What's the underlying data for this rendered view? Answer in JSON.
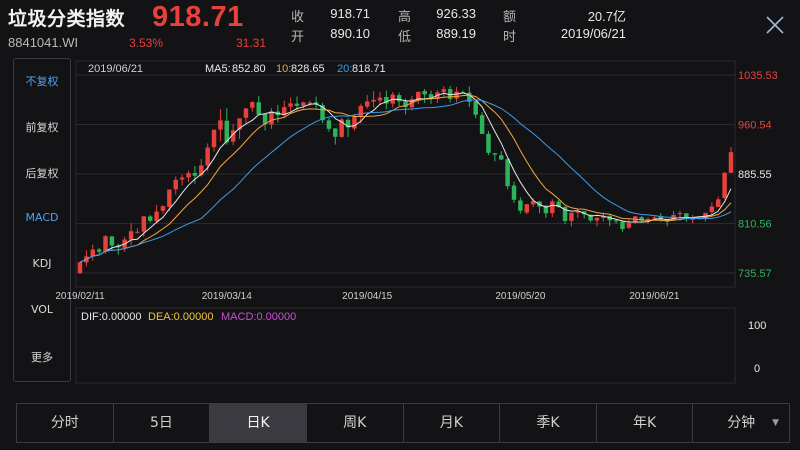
{
  "header": {
    "title": "垃圾分类指数",
    "code": "8841041.WI",
    "price": "918.71",
    "change_pct": "3.53%",
    "change": "31.31",
    "quote": [
      {
        "label": "收",
        "value": "918.71"
      },
      {
        "label": "开",
        "value": "890.10"
      },
      {
        "label": "高",
        "value": "926.33"
      },
      {
        "label": "低",
        "value": "889.19"
      },
      {
        "label": "额",
        "value": "20.7亿"
      },
      {
        "label": "时",
        "value": "2019/06/21"
      }
    ],
    "close_icon": "close-icon"
  },
  "sidebar": {
    "items": [
      {
        "label": "不复权",
        "active": true
      },
      {
        "label": "前复权",
        "active": false
      },
      {
        "label": "后复权",
        "active": false
      },
      {
        "label": "MACD",
        "active": true
      },
      {
        "label": "KDJ",
        "active": false
      },
      {
        "label": "VOL",
        "active": false
      },
      {
        "label": "更多",
        "active": false
      }
    ]
  },
  "legend": {
    "date": "2019/06/21",
    "ma5_label": "MA5:",
    "ma5_value": "852.80",
    "ma10_label": "10:",
    "ma10_value": "828.65",
    "ma20_label": "20:",
    "ma20_value": "818.71"
  },
  "macd_legend": {
    "dif": "DIF:0.00000",
    "dea": "DEA:0.00000",
    "macd": "MACD:0.00000",
    "axis_top": "100",
    "axis_bottom": "0"
  },
  "colors": {
    "up": "#e8403a",
    "down": "#2fb35a",
    "ma5": "#e8e8e8",
    "ma10": "#f2a83a",
    "ma20": "#3d9be9",
    "dea": "#f2c53d",
    "macd": "#c94fd6",
    "grid": "#2a2a30"
  },
  "chart_data": {
    "type": "candlestick",
    "y_ticks": [
      {
        "value": 1035.53,
        "label": "1035.53",
        "color": "#e8403a"
      },
      {
        "value": 960.54,
        "label": "960.54",
        "color": "#e8403a"
      },
      {
        "value": 885.55,
        "label": "885.55",
        "color": "#e8e8e8"
      },
      {
        "value": 810.56,
        "label": "810.56",
        "color": "#2fb35a"
      },
      {
        "value": 735.57,
        "label": "735.57",
        "color": "#2fb35a"
      }
    ],
    "ylim": [
      735.57,
      1035.53
    ],
    "x_ticks": [
      {
        "index": 0,
        "label": "2019/02/11"
      },
      {
        "index": 23,
        "label": "2019/03/14"
      },
      {
        "index": 45,
        "label": "2019/04/15"
      },
      {
        "index": 69,
        "label": "2019/05/20"
      },
      {
        "index": 90,
        "label": "2019/06/21"
      }
    ],
    "candles": [
      [
        735.3,
        751.9,
        734.2,
        752.3
      ],
      [
        751.6,
        760.7,
        745.7,
        770.0
      ],
      [
        761.2,
        771.2,
        754.2,
        778.5
      ],
      [
        771.2,
        767.8,
        764.1,
        773.6
      ],
      [
        768.1,
        791.2,
        764.6,
        793.2
      ],
      [
        791.0,
        777.2,
        770.0,
        791.9
      ],
      [
        777.1,
        774.4,
        763.3,
        780.0
      ],
      [
        773.2,
        786.3,
        767.8,
        790.1
      ],
      [
        786.2,
        798.9,
        778.1,
        811.0
      ],
      [
        797.8,
        798.0,
        795.5,
        803.2
      ],
      [
        798.3,
        821.5,
        790.4,
        822.0
      ],
      [
        821.3,
        814.6,
        812.0,
        823.3
      ],
      [
        814.1,
        828.6,
        810.5,
        838.7
      ],
      [
        829.7,
        836.9,
        825.4,
        837.9
      ],
      [
        835.7,
        862.1,
        829.4,
        862.1
      ],
      [
        862.3,
        876.8,
        854.6,
        882.0
      ],
      [
        877.2,
        880.1,
        868.2,
        884.5
      ],
      [
        880.4,
        886.9,
        873.6,
        890.6
      ],
      [
        887.1,
        883.0,
        870.8,
        897.7
      ],
      [
        883.8,
        898.6,
        881.4,
        908.5
      ],
      [
        898.5,
        925.6,
        889.8,
        931.9
      ],
      [
        926.3,
        952.6,
        919.7,
        952.6
      ],
      [
        953.0,
        966.8,
        935.1,
        983.8
      ],
      [
        966.2,
        933.6,
        929.9,
        985.1
      ],
      [
        934.6,
        951.7,
        929.3,
        961.2
      ],
      [
        952.7,
        969.9,
        938.6,
        969.9
      ],
      [
        970.7,
        984.8,
        962.2,
        985.7
      ],
      [
        986.1,
        994.5,
        980.0,
        995.6
      ],
      [
        994.2,
        975.4,
        974.4,
        1003.9
      ],
      [
        976.5,
        961.0,
        951.5,
        976.7
      ],
      [
        960.5,
        980.6,
        953.9,
        985.4
      ],
      [
        980.2,
        974.6,
        963.4,
        990.2
      ],
      [
        974.4,
        986.8,
        970.8,
        996.6
      ],
      [
        987.6,
        992.5,
        979.9,
        1001.5
      ],
      [
        992.1,
        988.8,
        982.1,
        1003.1
      ],
      [
        988.7,
        994.0,
        984.7,
        995.4
      ],
      [
        992.3,
        993.8,
        988.1,
        996.8
      ],
      [
        994.0,
        990.6,
        984.4,
        1002.7
      ],
      [
        990.0,
        967.0,
        962.5,
        993.3
      ],
      [
        966.7,
        954.1,
        949.7,
        970.3
      ],
      [
        954.6,
        942.0,
        930.1,
        955.1
      ],
      [
        941.8,
        968.1,
        940.6,
        970.6
      ],
      [
        967.5,
        956.1,
        941.7,
        969.8
      ],
      [
        954.5,
        972.2,
        951.2,
        976.6
      ],
      [
        972.1,
        988.7,
        962.1,
        992.1
      ],
      [
        987.6,
        995.5,
        984.5,
        1005.2
      ],
      [
        995.2,
        997.8,
        986.1,
        1011.1
      ],
      [
        997.0,
        1001.2,
        990.1,
        1010.2
      ],
      [
        1002.2,
        992.4,
        983.5,
        1011.9
      ],
      [
        992.1,
        1005.8,
        986.1,
        1009.7
      ],
      [
        1005.0,
        995.6,
        988.7,
        1008.8
      ],
      [
        995.7,
        986.9,
        975.9,
        999.7
      ],
      [
        986.6,
        998.7,
        982.0,
        1003.6
      ],
      [
        997.0,
        1009.9,
        991.3,
        1010.7
      ],
      [
        1011.3,
        1006.2,
        993.2,
        1014.4
      ],
      [
        1006.4,
        999.5,
        991.9,
        1011.9
      ],
      [
        999.1,
        1009.3,
        993.2,
        1012.9
      ],
      [
        1009.6,
        1014.1,
        1001.4,
        1018.8
      ],
      [
        1014.2,
        999.4,
        993.9,
        1018.9
      ],
      [
        999.7,
        1010.3,
        994.3,
        1017.3
      ],
      [
        1009.5,
        1008.9,
        1007.5,
        1011.9
      ],
      [
        1008.8,
        995.0,
        987.1,
        1018.3
      ],
      [
        996.0,
        975.3,
        970.2,
        996.6
      ],
      [
        974.6,
        946.3,
        946.2,
        979.2
      ],
      [
        946.3,
        917.6,
        914.3,
        950.8
      ],
      [
        917.0,
        915.0,
        904.7,
        917.2
      ],
      [
        913.9,
        907.5,
        906.3,
        920.3
      ],
      [
        908.0,
        867.1,
        862.2,
        908.8
      ],
      [
        868.0,
        846.5,
        841.7,
        874.0
      ],
      [
        845.5,
        829.9,
        825.5,
        850.2
      ],
      [
        827.1,
        839.8,
        824.5,
        840.4
      ],
      [
        839.5,
        844.4,
        835.3,
        849.3
      ],
      [
        843.9,
        836.2,
        826.3,
        844.8
      ],
      [
        837.7,
        826.0,
        819.1,
        838.1
      ],
      [
        826.3,
        844.0,
        820.4,
        847.5
      ],
      [
        843.7,
        835.5,
        834.2,
        846.1
      ],
      [
        835.8,
        814.4,
        809.3,
        836.2
      ],
      [
        814.5,
        826.8,
        806.2,
        827.3
      ],
      [
        826.9,
        828.5,
        819.1,
        833.6
      ],
      [
        829.1,
        824.5,
        818.2,
        829.3
      ],
      [
        823.7,
        815.2,
        812.5,
        824.3
      ],
      [
        815.1,
        819.0,
        806.4,
        820.6
      ],
      [
        819.1,
        821.6,
        813.7,
        827.1
      ],
      [
        822.0,
        815.5,
        806.4,
        823.2
      ],
      [
        815.4,
        813.8,
        810.5,
        817.0
      ],
      [
        813.4,
        802.2,
        798.1,
        814.8
      ],
      [
        804.2,
        811.2,
        802.3,
        816.6
      ],
      [
        812.4,
        821.4,
        810.1,
        822.0
      ],
      [
        820.2,
        814.8,
        813.6,
        821.8
      ],
      [
        815.9,
        817.3,
        810.1,
        820.1
      ],
      [
        818.5,
        819.7,
        815.9,
        821.9
      ],
      [
        821.9,
        816.4,
        813.2,
        826.1
      ],
      [
        816.4,
        813.2,
        806.3,
        818.0
      ],
      [
        815.2,
        823.6,
        815.2,
        829.5
      ],
      [
        824.7,
        826.4,
        815.1,
        830.1
      ],
      [
        826.0,
        817.3,
        813.0,
        826.2
      ],
      [
        816.8,
        817.6,
        810.7,
        823.5
      ],
      [
        817.4,
        819.5,
        817.0,
        821.7
      ],
      [
        818.6,
        826.7,
        813.6,
        826.7
      ],
      [
        828.0,
        836.3,
        824.1,
        842.3
      ],
      [
        835.7,
        847.2,
        835.0,
        851.5
      ],
      [
        849.2,
        887.4,
        846.7,
        888.5
      ],
      [
        887.4,
        918.7,
        887.4,
        926.3
      ]
    ]
  }
}
